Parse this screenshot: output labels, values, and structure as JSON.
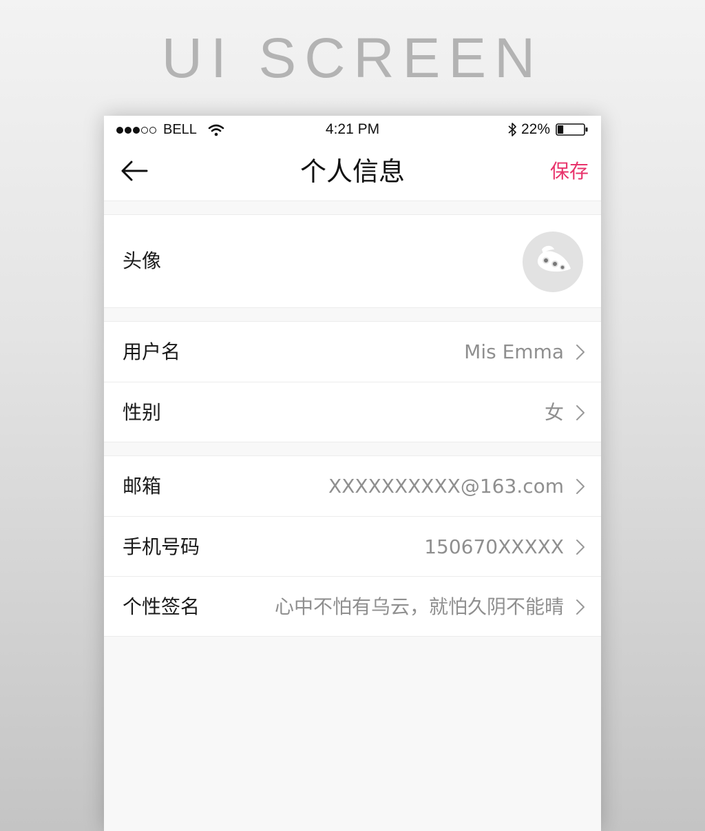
{
  "poster": {
    "title": "UI SCREEN"
  },
  "status_bar": {
    "carrier": "BELL",
    "time": "4:21 PM",
    "battery": "22%",
    "signal_bars_filled": 3,
    "signal_bars_total": 5,
    "battery_level": 0.22,
    "icons": [
      "signal-dots",
      "wifi-icon",
      "bluetooth-icon",
      "battery-icon"
    ]
  },
  "nav": {
    "title": "个人信息",
    "save_label": "保存",
    "back_icon": "back-arrow-icon",
    "accent_color": "#e8336b"
  },
  "profile": {
    "avatar_label": "头像",
    "avatar_icon": "peas-icon",
    "username_label": "用户名",
    "username_value": "Mis Emma",
    "gender_label": "性别",
    "gender_value": "女",
    "email_label": "邮箱",
    "email_value": "XXXXXXXXXX@163.com",
    "phone_label": "手机号码",
    "phone_value": "150670XXXXX",
    "signature_label": "个性签名",
    "signature_value": "心中不怕有乌云，就怕久阴不能晴"
  }
}
